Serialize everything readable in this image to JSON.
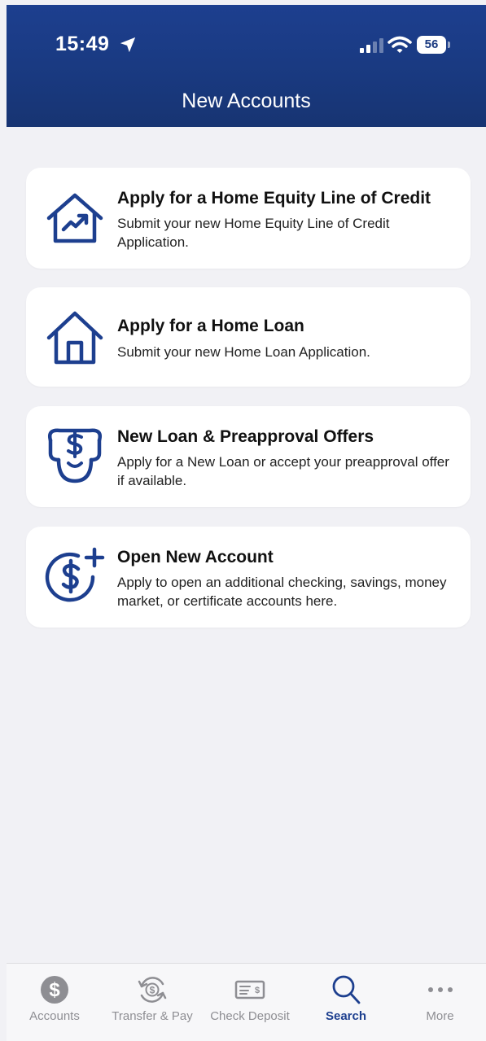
{
  "status_bar": {
    "time": "15:49",
    "battery": "56"
  },
  "header": {
    "title": "New Accounts"
  },
  "cards": [
    {
      "title": "Apply for a Home Equity Line of Credit",
      "description": "Submit your new Home Equity Line of Credit Application.",
      "icon": "house-chart-icon"
    },
    {
      "title": "Apply for a Home Loan",
      "description": "Submit your new Home Loan Application.",
      "icon": "house-icon"
    },
    {
      "title": "New Loan & Preapproval Offers",
      "description": "Apply for a New Loan or accept your preapproval offer if available.",
      "icon": "hand-money-icon"
    },
    {
      "title": "Open New Account",
      "description": "Apply to open an additional checking, savings, money market, or certificate accounts here.",
      "icon": "dollar-plus-icon"
    }
  ],
  "tabbar": {
    "tabs": [
      {
        "label": "Accounts",
        "icon": "dollar-circle-icon"
      },
      {
        "label": "Transfer & Pay",
        "icon": "transfer-icon"
      },
      {
        "label": "Check Deposit",
        "icon": "check-icon"
      },
      {
        "label": "Search",
        "icon": "search-icon"
      },
      {
        "label": "More",
        "icon": "more-icon"
      }
    ],
    "active": "Search"
  },
  "colors": {
    "header_blue": "#1d3f8f",
    "icon_blue": "#1d3f8f",
    "background": "#f1f1f5",
    "inactive_tab": "#8e8e93"
  }
}
